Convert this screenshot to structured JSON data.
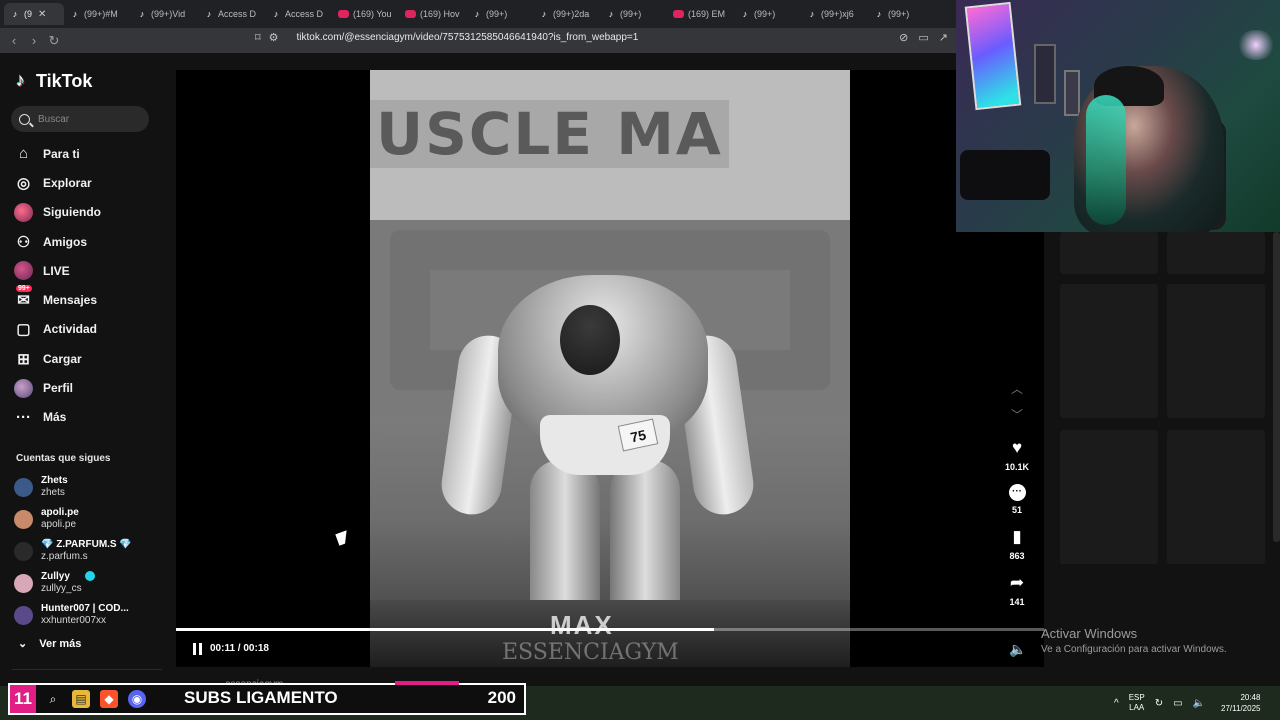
{
  "browser": {
    "tabs": [
      {
        "label": "(9",
        "icon": "tiktok-icon",
        "active": true
      },
      {
        "label": "(99+)#M",
        "icon": "tiktok-icon"
      },
      {
        "label": "(99+)Vid",
        "icon": "tiktok-icon"
      },
      {
        "label": "Access D",
        "icon": "tiktok-icon"
      },
      {
        "label": "Access D",
        "icon": "tiktok-icon"
      },
      {
        "label": "(169) You",
        "icon": "youtube-icon"
      },
      {
        "label": "(169) Hov",
        "icon": "youtube-icon"
      },
      {
        "label": "(99+)",
        "icon": "tiktok-icon"
      },
      {
        "label": "(99+)2da",
        "icon": "tiktok-icon"
      },
      {
        "label": "(99+)",
        "icon": "tiktok-icon"
      },
      {
        "label": "(169) EM",
        "icon": "youtube-icon"
      },
      {
        "label": "(99+)",
        "icon": "tiktok-icon"
      },
      {
        "label": "(99+)xj6",
        "icon": "tiktok-icon"
      },
      {
        "label": "(99+)",
        "icon": "tiktok-icon"
      }
    ],
    "url": "tiktok.com/@essenciagym/video/7575312585046641940?is_from_webapp=1"
  },
  "sidebar": {
    "brand": "TikTok",
    "search_placeholder": "Buscar",
    "nav": [
      {
        "label": "Para ti",
        "icon": "home-icon"
      },
      {
        "label": "Explorar",
        "icon": "compass-icon"
      },
      {
        "label": "Siguiendo",
        "icon": "avatar-icon"
      },
      {
        "label": "Amigos",
        "icon": "friends-icon"
      },
      {
        "label": "LIVE",
        "icon": "live-avatar-icon"
      },
      {
        "label": "Mensajes",
        "icon": "message-icon",
        "badge": "99+"
      },
      {
        "label": "Actividad",
        "icon": "activity-icon"
      },
      {
        "label": "Cargar",
        "icon": "upload-icon"
      },
      {
        "label": "Perfil",
        "icon": "profile-avatar-icon"
      },
      {
        "label": "Más",
        "icon": "more-icon"
      }
    ],
    "following_title": "Cuentas que sigues",
    "accounts": [
      {
        "name": "Zhets",
        "user": "zhets",
        "color": "#3b5a8a"
      },
      {
        "name": "apoli.pe",
        "user": "apoli.pe",
        "color": "#c88a6a"
      },
      {
        "name": "💎 Z.PARFUM.S 💎",
        "user": "z.parfum.s",
        "color": "#2a2a2a"
      },
      {
        "name": "Zullyy",
        "user": "zullyy_cs",
        "color": "#d8a8b8",
        "verified": true
      },
      {
        "name": "Hunter007 | COD...",
        "user": "xxhunter007xx",
        "color": "#5a4a8a"
      }
    ],
    "see_more": "Ver más"
  },
  "video": {
    "banner_text": "USCLE MA",
    "bib_number": "75",
    "watermark_top": "MAX",
    "watermark_bottom": "ESSENCIAGYM",
    "progress": 0.62,
    "time": "00:11 / 00:18"
  },
  "actions": {
    "likes": "10.1K",
    "comments": "51",
    "saves": "863",
    "shares": "141"
  },
  "windows_notice": {
    "line1": "Activar Windows",
    "line2": "Ve a Configuración para activar Windows."
  },
  "overlay": {
    "number": "11",
    "label": "SUBS LIGAMENTO",
    "count": "200",
    "ghost_text": "essenciagym"
  },
  "taskbar": {
    "lang_top": "ESP",
    "lang_bottom": "LAA",
    "time": "20:48",
    "date": "27/11/2025"
  }
}
